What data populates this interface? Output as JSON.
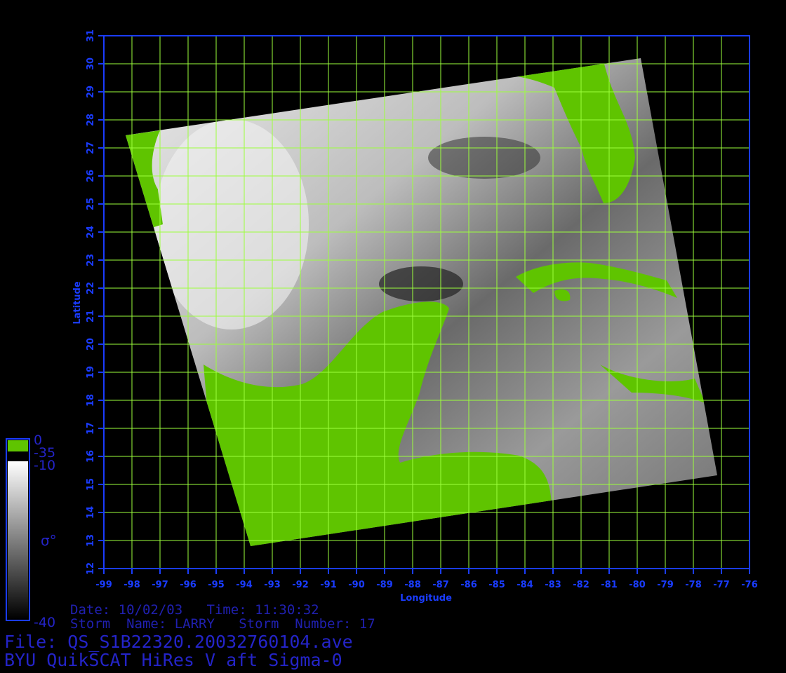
{
  "map": {
    "lon_ticks": [
      "-99",
      "-98",
      "-97",
      "-96",
      "-95",
      "-94",
      "-93",
      "-92",
      "-91",
      "-90",
      "-89",
      "-88",
      "-87",
      "-86",
      "-85",
      "-84",
      "-83",
      "-82",
      "-81",
      "-80",
      "-79",
      "-78",
      "-77",
      "-76"
    ],
    "lat_ticks": [
      "12",
      "13",
      "14",
      "15",
      "16",
      "17",
      "18",
      "19",
      "20",
      "21",
      "22",
      "23",
      "24",
      "25",
      "26",
      "27",
      "28",
      "29",
      "30",
      "31"
    ],
    "lon_range": [
      -99,
      -76
    ],
    "lat_range": [
      12,
      31
    ],
    "xlabel": "Longitude",
    "ylabel": "Latitude",
    "colors": {
      "axis": "#1a3cff",
      "grid": "#9cff3c",
      "land": "#5fc400",
      "water_light": "#d8d8d8",
      "water_dark": "#3a3a3a"
    }
  },
  "colorbar": {
    "top_label": "0",
    "green_label": "-35",
    "upper_label": "-10",
    "bottom_label": "-40",
    "symbol": "σ°"
  },
  "info": {
    "date_time": "Date: 10/02/03   Time: 11:30:32",
    "storm": "Storm  Name: LARRY   Storm  Number: 17",
    "file": "File: QS_S1B22320.20032760104.ave",
    "product": "BYU QuikSCAT HiRes V aft Sigma-0"
  }
}
